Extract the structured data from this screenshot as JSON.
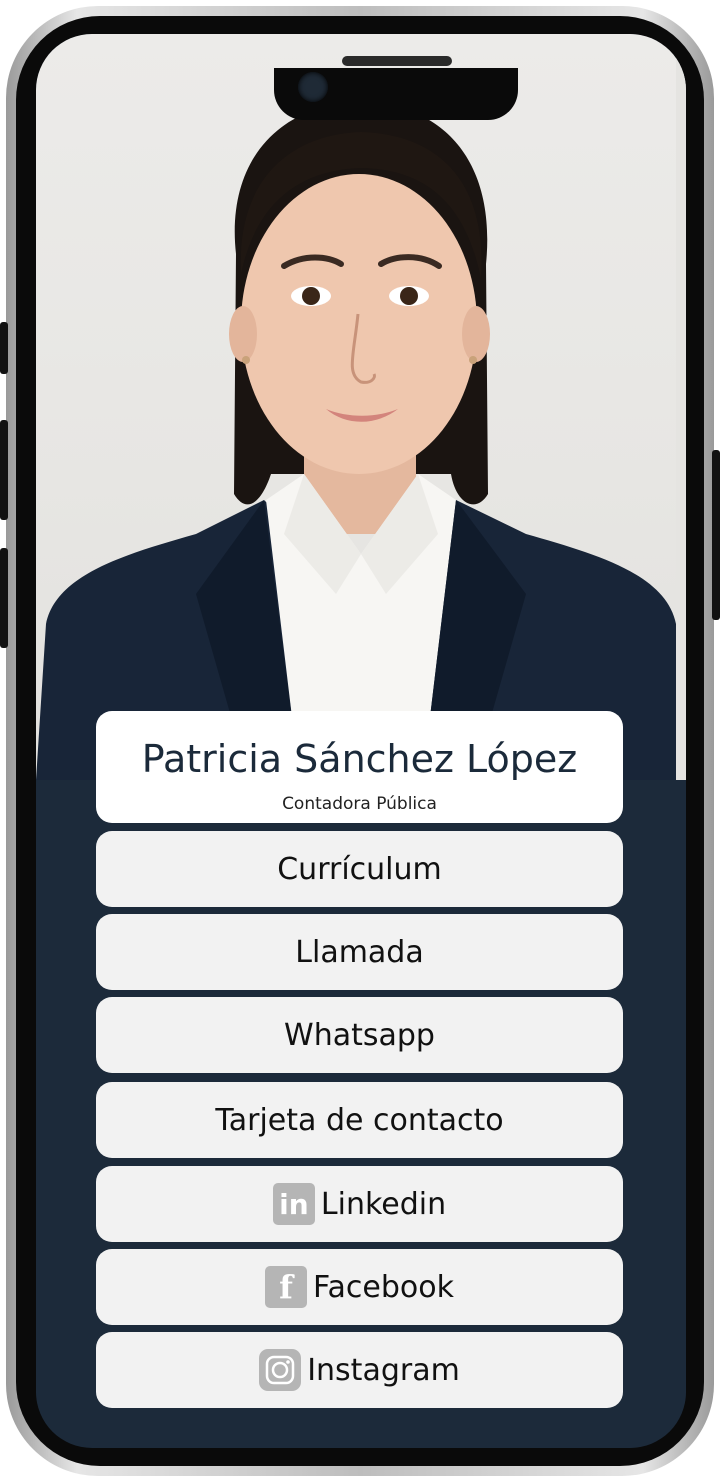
{
  "profile": {
    "name": "Patricia Sánchez López",
    "title": "Contadora Pública"
  },
  "links": [
    {
      "label": "Currículum"
    },
    {
      "label": "Llamada"
    },
    {
      "label": "Whatsapp"
    },
    {
      "label": "Tarjeta de contacto"
    },
    {
      "label": "Linkedin",
      "icon": "linkedin-icon",
      "icon_text": "in"
    },
    {
      "label": "Facebook",
      "icon": "facebook-icon",
      "icon_text": "f"
    },
    {
      "label": "Instagram",
      "icon": "instagram-icon"
    }
  ],
  "colors": {
    "background_navy": "#1c2a3a",
    "button_bg": "#f2f2f2",
    "icon_gray": "#b5b5b5"
  }
}
